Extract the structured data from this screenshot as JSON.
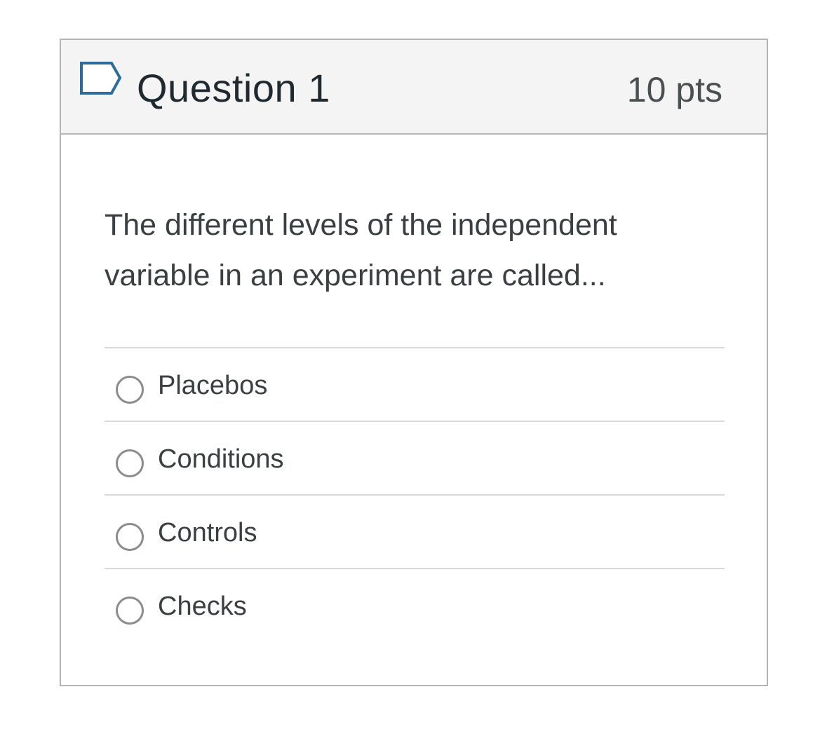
{
  "question": {
    "flag_icon": "flag-outline-icon",
    "title": "Question 1",
    "points": "10 pts",
    "text": "The different levels of the independent variable in an experiment are called...",
    "answers": [
      {
        "label": "Placebos",
        "selected": false
      },
      {
        "label": "Conditions",
        "selected": false
      },
      {
        "label": "Controls",
        "selected": false
      },
      {
        "label": "Checks",
        "selected": false
      }
    ]
  },
  "colors": {
    "header_bg": "#f4f4f4",
    "border": "#b3b3b3",
    "flag_outline": "#2d6b9a",
    "divider": "#d8d8d8"
  }
}
